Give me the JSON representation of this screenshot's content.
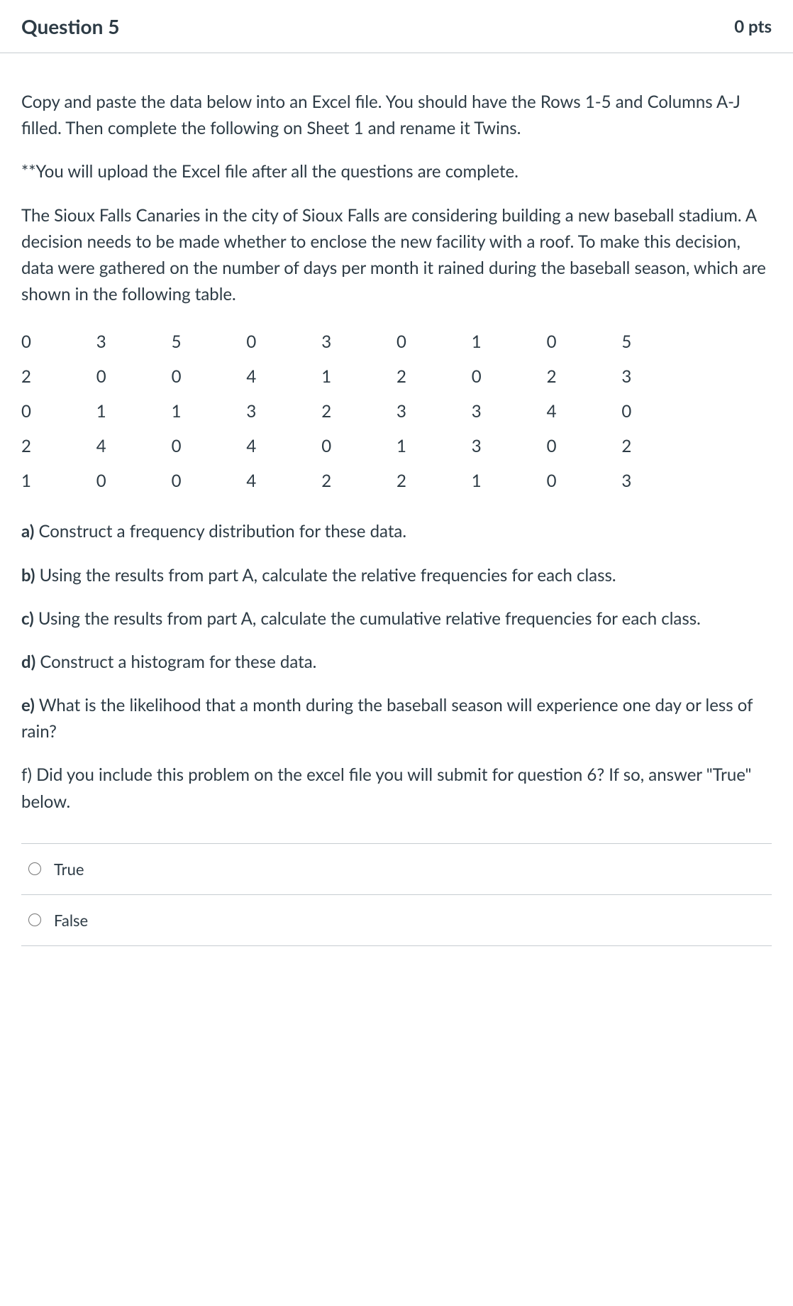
{
  "header": {
    "title": "Question 5",
    "points": "0 pts"
  },
  "body": {
    "p1": "Copy and paste the data below into an Excel file. You should have the Rows 1-5 and Columns A-J filled. Then complete the following on Sheet 1 and rename it Twins.",
    "p2": "**You will upload the Excel file after all the questions are complete.",
    "p3": "The Sioux Falls Canaries in the city of Sioux Falls are considering building a new baseball stadium. A decision needs to be made whether to enclose the new facility with a roof. To make this decision, data were gathered on the number of days per month it rained during the baseball season, which are shown in the following table."
  },
  "table": {
    "rows": [
      [
        "0",
        "3",
        "5",
        "0",
        "3",
        "0",
        "1",
        "0",
        "5",
        ""
      ],
      [
        "2",
        "0",
        "0",
        "4",
        "1",
        "2",
        "0",
        "2",
        "3",
        ""
      ],
      [
        "0",
        "1",
        "1",
        "3",
        "2",
        "3",
        "3",
        "4",
        "0",
        ""
      ],
      [
        "2",
        "4",
        "0",
        "4",
        "0",
        "1",
        "3",
        "0",
        "2",
        ""
      ],
      [
        "1",
        "0",
        "0",
        "4",
        "2",
        "2",
        "1",
        "0",
        "3",
        ""
      ]
    ]
  },
  "subparts": {
    "a": {
      "label": "a)",
      "text": " Construct a frequency distribution for these data."
    },
    "b": {
      "label": "b)",
      "text": " Using the results from part A, calculate the relative frequencies for each class."
    },
    "c": {
      "label": "c)",
      "text": " Using the results from part A, calculate the cumulative relative frequencies for each class."
    },
    "d": {
      "label": "d)",
      "text": " Construct a histogram for these data."
    },
    "e": {
      "label": "e)",
      "text": " What is the likelihood that a month during the baseball season will experience one day or less of rain?"
    },
    "f": {
      "label": "f)",
      "text": " Did you include this problem on the excel file you will submit for question 6? If so, answer \"True\" below."
    }
  },
  "options": {
    "true": "True",
    "false": "False"
  }
}
